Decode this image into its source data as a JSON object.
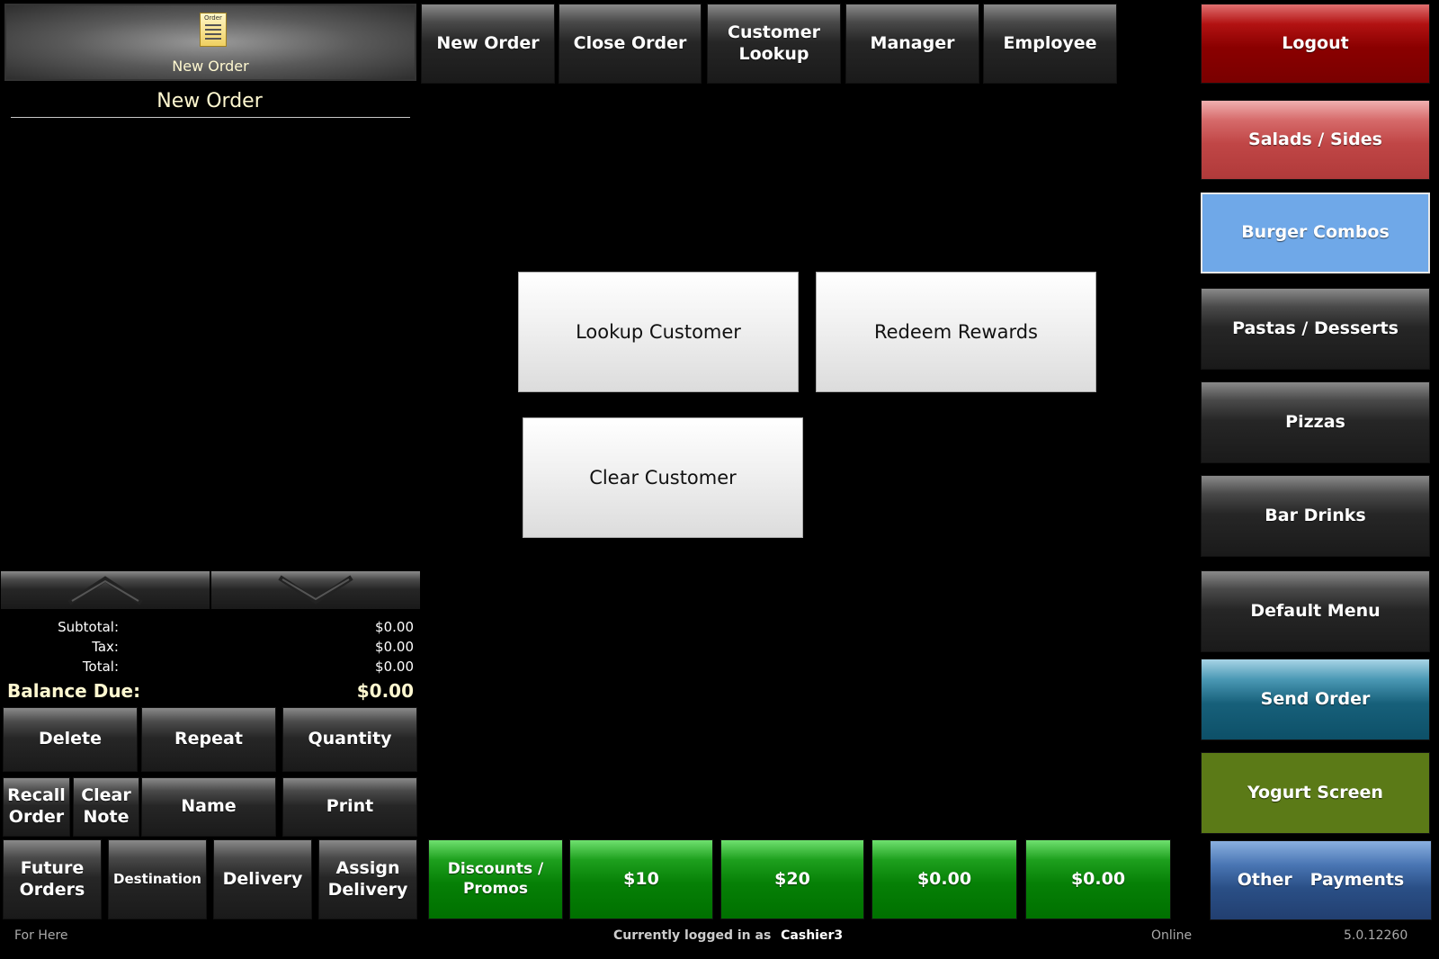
{
  "header": {
    "order_icon_label": "Order",
    "new_order_tile": "New Order",
    "order_title": "New Order"
  },
  "top_nav": {
    "new_order": "New Order",
    "close_order": "Close Order",
    "customer_lookup": "Customer Lookup",
    "manager": "Manager",
    "employee": "Employee"
  },
  "right_menu": {
    "logout": "Logout",
    "salads_sides": "Salads / Sides",
    "burger_combos": "Burger Combos",
    "pastas_desserts": "Pastas / Desserts",
    "pizzas": "Pizzas",
    "bar_drinks": "Bar Drinks",
    "default_menu": "Default Menu",
    "send_order": "Send Order",
    "yogurt_screen": "Yogurt Screen",
    "other_payments": "Other   Payments"
  },
  "center": {
    "lookup_customer": "Lookup Customer",
    "redeem_rewards": "Redeem Rewards",
    "clear_customer": "Clear Customer"
  },
  "totals": {
    "subtotal_label": "Subtotal:",
    "subtotal": "$0.00",
    "tax_label": "Tax:",
    "tax": "$0.00",
    "total_label": "Total:",
    "total": "$0.00",
    "balance_label": "Balance Due:",
    "balance": "$0.00"
  },
  "actions": {
    "delete": "Delete",
    "repeat": "Repeat",
    "quantity": "Quantity",
    "recall_order": "Recall Order",
    "clear_note": "Clear Note",
    "name": "Name",
    "print": "Print",
    "future_orders": "Future Orders",
    "destination": "Destination",
    "delivery": "Delivery",
    "assign_delivery": "Assign Delivery"
  },
  "payments": {
    "discounts": "Discounts / Promos",
    "p10": "$10",
    "p20": "$20",
    "p_a": "$0.00",
    "p_b": "$0.00"
  },
  "status_bar": {
    "mode": "For Here",
    "logged_in_label": "Currently logged in as",
    "user": "Cashier3",
    "connection": "Online",
    "version": "5.0.12260"
  },
  "colors": {
    "logout": "#8a0000",
    "salads": "#c04646",
    "burger_combos": "#6fa8e8",
    "send_order": "#17607a",
    "yogurt": "#5b7a17",
    "other_payments": "#2a4f86",
    "payment_green": "#068006"
  }
}
